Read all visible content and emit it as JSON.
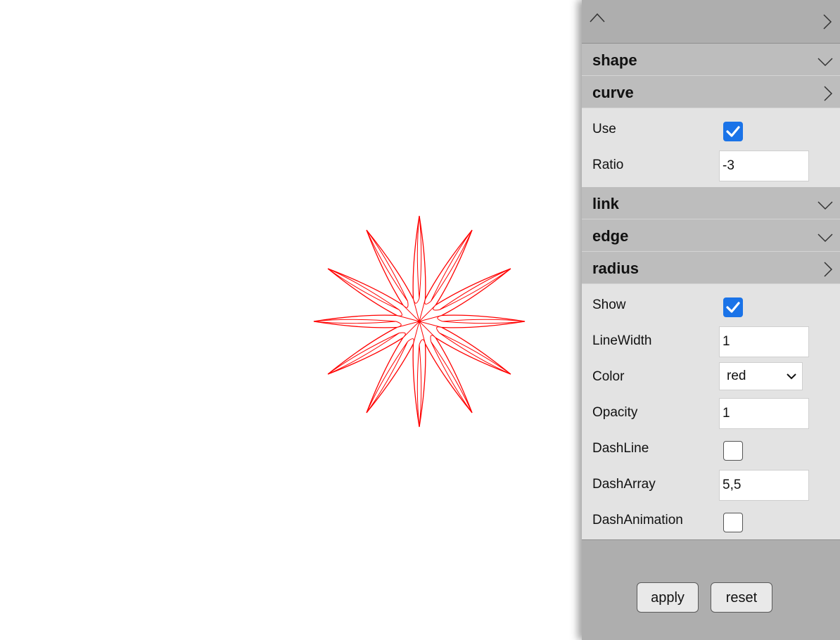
{
  "sections": {
    "shape": {
      "title": "shape",
      "expanded": false
    },
    "curve": {
      "title": "curve",
      "expanded": true,
      "use_label": "Use",
      "use_checked": true,
      "ratio_label": "Ratio",
      "ratio_value": "-3"
    },
    "link": {
      "title": "link",
      "expanded": false
    },
    "edge": {
      "title": "edge",
      "expanded": false
    },
    "radius": {
      "title": "radius",
      "expanded": true,
      "show_label": "Show",
      "show_checked": true,
      "linewidth_label": "LineWidth",
      "linewidth_value": "1",
      "color_label": "Color",
      "color_value": "red",
      "opacity_label": "Opacity",
      "opacity_value": "1",
      "dashline_label": "DashLine",
      "dashline_checked": false,
      "dasharray_label": "DashArray",
      "dasharray_value": "5,5",
      "dashanimation_label": "DashAnimation",
      "dashanimation_checked": false
    }
  },
  "buttons": {
    "apply": "apply",
    "reset": "reset"
  },
  "figure": {
    "stroke_color": "#ff0000",
    "petals": 12,
    "curve_ratio": -3
  },
  "icons": {
    "collapse": "chevron-up-icon",
    "panel_toggle": "chevron-right-icon",
    "section_collapsed": "chevron-down-icon",
    "section_expanded": "chevron-right-icon",
    "checkbox_checked": "check-icon",
    "select": "chevron-down-icon"
  },
  "colors": {
    "panel_bg": "#aeaeae",
    "section_header": "#bdbdbd",
    "section_body": "#e3e3e3",
    "checkbox_accent": "#1a73e8"
  }
}
